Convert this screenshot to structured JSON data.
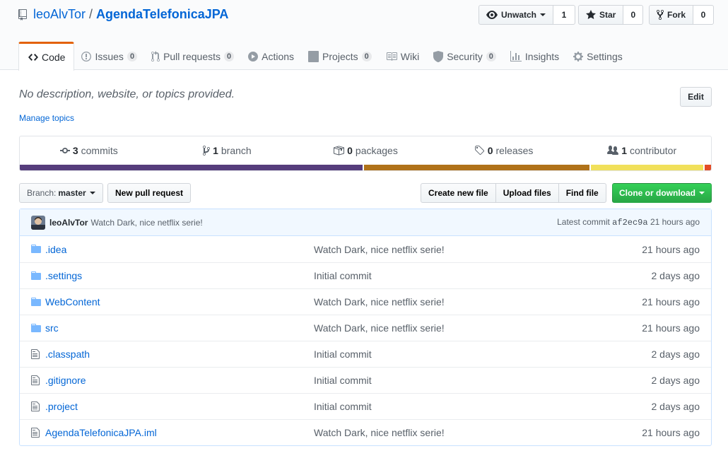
{
  "repo": {
    "owner": "leoAlvTor",
    "separator": "/",
    "name": "AgendaTelefonicaJPA"
  },
  "actions": {
    "watch_label": "Unwatch",
    "watch_count": "1",
    "star_label": "Star",
    "star_count": "0",
    "fork_label": "Fork",
    "fork_count": "0"
  },
  "tabs": [
    {
      "label": "Code",
      "icon": "code-icon",
      "counter": ""
    },
    {
      "label": "Issues",
      "icon": "issue-opened-icon",
      "counter": "0"
    },
    {
      "label": "Pull requests",
      "icon": "git-pull-request-icon",
      "counter": "0"
    },
    {
      "label": "Actions",
      "icon": "play-icon",
      "counter": ""
    },
    {
      "label": "Projects",
      "icon": "project-icon",
      "counter": "0"
    },
    {
      "label": "Wiki",
      "icon": "book-icon",
      "counter": ""
    },
    {
      "label": "Security",
      "icon": "shield-icon",
      "counter": "0"
    },
    {
      "label": "Insights",
      "icon": "graph-icon",
      "counter": ""
    },
    {
      "label": "Settings",
      "icon": "gear-icon",
      "counter": ""
    }
  ],
  "about": {
    "description": "No description, website, or topics provided.",
    "edit_label": "Edit",
    "manage_topics": "Manage topics"
  },
  "summary": {
    "commits_count": "3",
    "commits_label": "commits",
    "branch_count": "1",
    "branch_label": "branch",
    "packages_count": "0",
    "packages_label": "packages",
    "releases_count": "0",
    "releases_label": "releases",
    "contributors_count": "1",
    "contributors_label": "contributor"
  },
  "language_bar": [
    {
      "color": "#563d7c",
      "share": 49.6
    },
    {
      "color": "#b07219",
      "share": 32.8
    },
    {
      "color": "#f1e05a",
      "share": 16.5
    },
    {
      "color": "#e34c26",
      "share": 1.1
    }
  ],
  "toolbar": {
    "branch_prefix": "Branch:",
    "branch_name": "master",
    "new_pr": "New pull request",
    "create_file": "Create new file",
    "upload_files": "Upload files",
    "find_file": "Find file",
    "clone": "Clone or download"
  },
  "latest_commit": {
    "author": "leoAlvTor",
    "message": "Watch Dark, nice netflix serie!",
    "prefix": "Latest commit",
    "sha": "af2ec9a",
    "age": "21 hours ago"
  },
  "files": [
    {
      "type": "dir",
      "name": ".idea",
      "message": "Watch Dark, nice netflix serie!",
      "age": "21 hours ago"
    },
    {
      "type": "dir",
      "name": ".settings",
      "message": "Initial commit",
      "age": "2 days ago"
    },
    {
      "type": "dir",
      "name": "WebContent",
      "message": "Watch Dark, nice netflix serie!",
      "age": "21 hours ago"
    },
    {
      "type": "dir",
      "name": "src",
      "message": "Watch Dark, nice netflix serie!",
      "age": "21 hours ago"
    },
    {
      "type": "file",
      "name": ".classpath",
      "message": "Initial commit",
      "age": "2 days ago"
    },
    {
      "type": "file",
      "name": ".gitignore",
      "message": "Initial commit",
      "age": "2 days ago"
    },
    {
      "type": "file",
      "name": ".project",
      "message": "Initial commit",
      "age": "2 days ago"
    },
    {
      "type": "file",
      "name": "AgendaTelefonicaJPA.iml",
      "message": "Watch Dark, nice netflix serie!",
      "age": "21 hours ago"
    }
  ]
}
